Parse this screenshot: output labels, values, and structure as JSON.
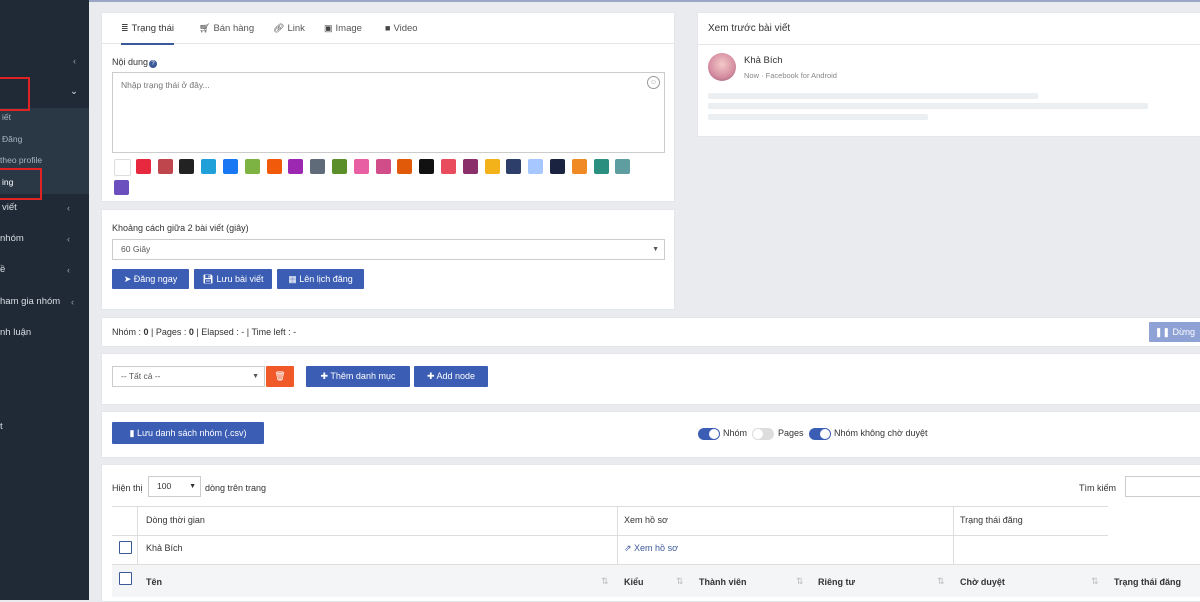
{
  "sidebar": {
    "items": [
      {
        "label": "",
        "arrow": "‹"
      },
      {
        "label": "",
        "arrow": "⌄"
      },
      {
        "label": "iết"
      },
      {
        "label": "Đăng"
      },
      {
        "label": "theo profile"
      },
      {
        "label": "ing"
      },
      {
        "label": "viết",
        "arrow": "‹"
      },
      {
        "label": "nhóm",
        "arrow": "‹"
      },
      {
        "label": "ề",
        "arrow": "‹"
      },
      {
        "label": "ham gia nhóm",
        "arrow": "‹"
      },
      {
        "label": "nh luận"
      },
      {
        "label": "t"
      }
    ]
  },
  "composer": {
    "tabs": [
      {
        "label": "Trạng thái",
        "icon": "status-icon"
      },
      {
        "label": "Bán hàng",
        "icon": "cart-icon"
      },
      {
        "label": "Link",
        "icon": "link-icon"
      },
      {
        "label": "Image",
        "icon": "image-icon"
      },
      {
        "label": "Video",
        "icon": "video-icon"
      }
    ],
    "content_label": "Nội dung",
    "placeholder": "Nhập trạng thái ở đây...",
    "swatch_colors": [
      "#ffffff",
      "#e8283f",
      "#c0464e",
      "#222222",
      "#1fa0d8",
      "#1877f2",
      "#7cb342",
      "#f05a0a",
      "#9c27b0",
      "#5f6b78",
      "#5a8f29",
      "#e85fa4",
      "#d04d8a",
      "#e05a0a",
      "#111111",
      "#e84c5d",
      "#8b2f6b",
      "#f3b11a",
      "#2d3e6b",
      "#a6c7ff",
      "#1a2440",
      "#f08a24",
      "#2a8f7f",
      "#5f9ea0",
      "#6c4fbf"
    ]
  },
  "schedule": {
    "label": "Khoảng cách giữa 2 bài viết (giây)",
    "select_value": "60 Giây",
    "buttons": {
      "post_now": "Đăng ngay",
      "save_post": "Lưu bài viết",
      "schedule": "Lên lịch đăng"
    }
  },
  "preview": {
    "title": "Xem trước bài viết",
    "name": "Khả Bích",
    "meta": "Now · Facebook for Android"
  },
  "status_bar": {
    "text_parts": [
      "Nhóm : ",
      "0",
      " | Pages : ",
      "0",
      " | Elapsed : - | Time left : -"
    ],
    "stop_label": "Dừng"
  },
  "category": {
    "select_value": "-- Tất cả --",
    "add_category": "Thêm danh mục",
    "add_node": "Add node"
  },
  "export": {
    "save_csv": "Lưu danh sách nhóm (.csv)",
    "toggles": [
      {
        "label": "Nhóm",
        "on": true
      },
      {
        "label": "Pages",
        "on": false
      },
      {
        "label": "Nhóm không chờ duyệt",
        "on": true
      }
    ]
  },
  "table": {
    "show_prefix": "Hiện thị",
    "page_size": "100",
    "show_suffix": "dòng trên trang",
    "search_label": "Tìm kiếm",
    "group_headers": [
      "Dòng thời gian",
      "Xem hồ sơ",
      "Trạng thái đăng"
    ],
    "profile_row": {
      "name": "Khả Bích",
      "link": "Xem hồ sơ"
    },
    "columns": [
      "Tên",
      "Kiểu",
      "Thành viên",
      "Riêng tư",
      "Chờ duyệt",
      "Trạng thái đăng"
    ]
  },
  "colors": {
    "accent": "#3b5db4",
    "sidebar": "#1f2a36",
    "danger": "#f05a28",
    "highlight": "#e02424"
  }
}
